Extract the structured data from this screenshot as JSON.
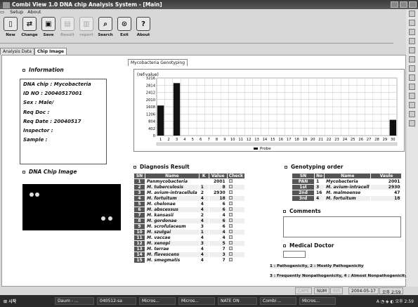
{
  "window": {
    "title": "Combi View 1.0 DNA chip Analysis System - [Main]"
  },
  "menu": [
    "Setup",
    "About"
  ],
  "toolbar": [
    {
      "label": "New",
      "icon": "new-document-icon",
      "enabled": true
    },
    {
      "label": "Change",
      "icon": "change-icon",
      "enabled": true
    },
    {
      "label": "Save",
      "icon": "save-icon",
      "enabled": true
    },
    {
      "label": "Result",
      "icon": "result-icon",
      "enabled": false
    },
    {
      "label": "report",
      "icon": "report-icon",
      "enabled": false
    },
    {
      "label": "Search",
      "icon": "search-icon",
      "enabled": true
    },
    {
      "label": "Exit",
      "icon": "exit-icon",
      "enabled": true
    },
    {
      "label": "About",
      "icon": "help-icon",
      "enabled": true
    }
  ],
  "tabs": [
    "Analysis Data",
    "Chip Image"
  ],
  "info": {
    "heading": "Information",
    "lines": [
      "DNA chip : Mycobacteria",
      "ID NO : 20040517001",
      "Sex : Male/",
      "Req Doc :",
      "Req Date : 20040517",
      "Inspector :",
      "Sample :"
    ]
  },
  "chip_heading": "DNA Chip Image",
  "chart_tab": "Mycobacteria Genotyping",
  "chart_data": {
    "type": "bar",
    "ylabel": "(ref-value)",
    "yticks": [
      "3216",
      "2814",
      "2412",
      "2010",
      "1608",
      "1206",
      "804",
      "402",
      "0"
    ],
    "categories": [
      "1",
      "2",
      "3",
      "4",
      "5",
      "6",
      "7",
      "8",
      "9",
      "10",
      "11",
      "12",
      "13",
      "14",
      "15",
      "16",
      "17",
      "18",
      "19",
      "20",
      "21",
      "22",
      "23",
      "24",
      "25",
      "26",
      "27",
      "28",
      "29",
      "30"
    ],
    "values": [
      1680,
      0,
      2930,
      0,
      0,
      0,
      0,
      0,
      0,
      0,
      0,
      0,
      0,
      0,
      0,
      0,
      0,
      0,
      0,
      0,
      0,
      0,
      0,
      0,
      0,
      0,
      0,
      0,
      0,
      880
    ],
    "legend": "Probe",
    "ylim": [
      0,
      3216
    ]
  },
  "diag": {
    "heading": "Diagnosis Result",
    "headers": [
      "SN",
      "Name",
      "K",
      "Value",
      "Check"
    ],
    "rows": [
      [
        "1",
        "Panmycobacteria",
        "",
        "2001"
      ],
      [
        "2",
        "M. tuberculosis",
        "1",
        "8"
      ],
      [
        "3",
        "M. avium-intracellula",
        "2",
        "2930"
      ],
      [
        "4",
        "M. fortuitum",
        "4",
        "18"
      ],
      [
        "5",
        "M. chelonae",
        "4",
        "6"
      ],
      [
        "6",
        "M. abscessus",
        "4",
        "6"
      ],
      [
        "7",
        "M. kansasii",
        "2",
        "4"
      ],
      [
        "8",
        "M. gordonae",
        "4",
        "6"
      ],
      [
        "9",
        "M. scrofulaceum",
        "3",
        "6"
      ],
      [
        "10",
        "M. szulgai",
        "1",
        "4"
      ],
      [
        "11",
        "M. vaccae",
        "4",
        "4"
      ],
      [
        "12",
        "M. xenopi",
        "3",
        "5"
      ],
      [
        "13",
        "M. terrae",
        "4",
        "7"
      ],
      [
        "14",
        "M. flavescens",
        "4",
        "3"
      ],
      [
        "15",
        "M. smegmatis",
        "4",
        "7"
      ]
    ]
  },
  "gord": {
    "heading": "Genotyping order",
    "headers": [
      "SN",
      "No",
      "Name",
      "Vaule"
    ],
    "rows": [
      [
        "PAN",
        "1",
        "Mycobacteria",
        "2001"
      ],
      [
        "1st",
        "3",
        "M. avium-intracell",
        "2930"
      ],
      [
        "2nd",
        "16",
        "M. malmoense",
        "47"
      ],
      [
        "3rd",
        "4",
        "M. fortuitum",
        "18"
      ]
    ]
  },
  "comments_heading": "Comments",
  "medical_heading": "Medical Doctor",
  "notes": [
    "1 : Pathogenicity, 2 : Mostly Pathogenicity",
    "3 : Frequently Nonpathogenicity, 4 : Almost Nonpathogenicity"
  ],
  "status": {
    "caps": "CAPS",
    "num": "NUM",
    "ins": "INS",
    "date": "2004-05-17",
    "time": "오후 2:59"
  },
  "taskbar": {
    "start": "시작",
    "items": [
      "Daum - ...",
      "040512-sa",
      "Micros...",
      "Micros...",
      "NATE ON",
      "Combi ...",
      "Micros..."
    ],
    "clock": "오후 2:59"
  }
}
